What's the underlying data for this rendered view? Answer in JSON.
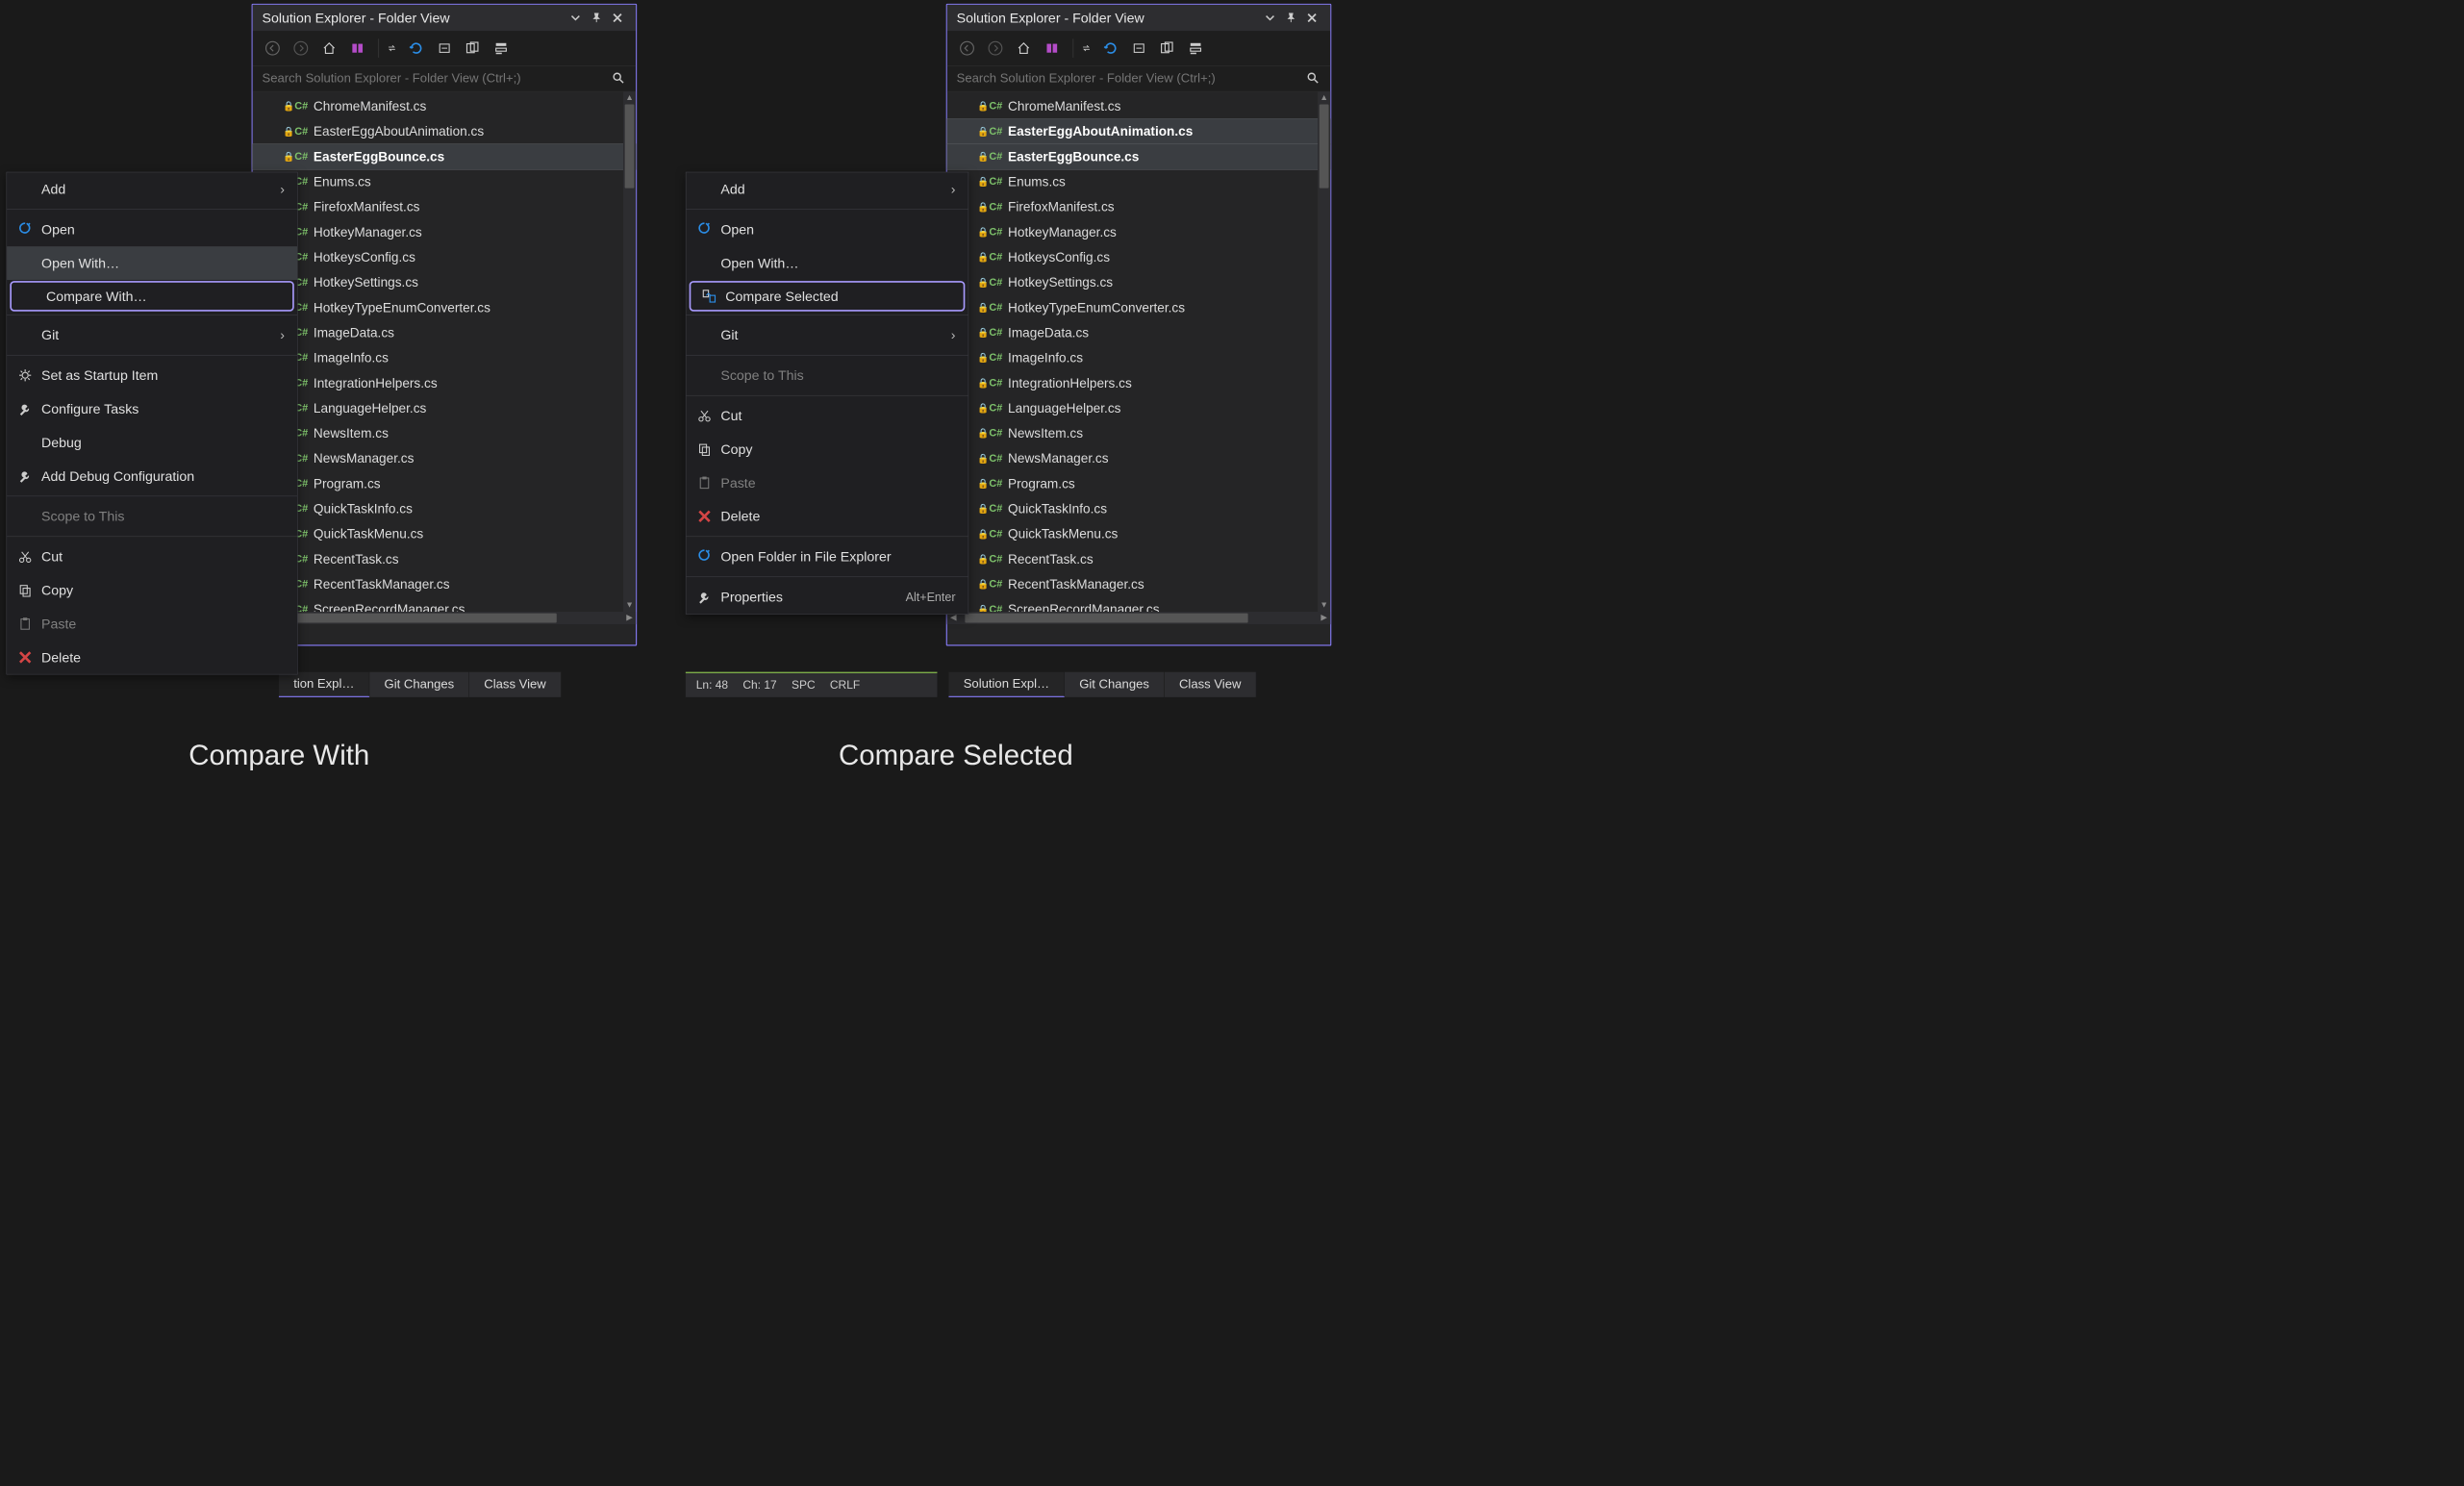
{
  "panel": {
    "title": "Solution Explorer - Folder View",
    "search_placeholder": "Search Solution Explorer - Folder View (Ctrl+;)",
    "files": [
      "ChromeManifest.cs",
      "EasterEggAboutAnimation.cs",
      "EasterEggBounce.cs",
      "Enums.cs",
      "FirefoxManifest.cs",
      "HotkeyManager.cs",
      "HotkeysConfig.cs",
      "HotkeySettings.cs",
      "HotkeyTypeEnumConverter.cs",
      "ImageData.cs",
      "ImageInfo.cs",
      "IntegrationHelpers.cs",
      "LanguageHelper.cs",
      "NewsItem.cs",
      "NewsManager.cs",
      "Program.cs",
      "QuickTaskInfo.cs",
      "QuickTaskMenu.cs",
      "RecentTask.cs",
      "RecentTaskManager.cs",
      "ScreenRecordManager.cs"
    ],
    "cs_badge": "C#",
    "left_selected": [
      2
    ],
    "right_selected": [
      1,
      2
    ]
  },
  "tabs": {
    "sol_expl_trunc": "tion Expl…",
    "sol_expl": "Solution Expl…",
    "git_changes": "Git Changes",
    "class_view": "Class View"
  },
  "status": {
    "ln": "Ln: 48",
    "ch": "Ch: 17",
    "spc": "SPC",
    "crlf": "CRLF"
  },
  "ctx1": {
    "add": "Add",
    "open": "Open",
    "open_with": "Open With…",
    "compare_with": "Compare With…",
    "git": "Git",
    "set_startup": "Set as Startup Item",
    "configure_tasks": "Configure Tasks",
    "debug": "Debug",
    "add_debug_cfg": "Add Debug Configuration",
    "scope": "Scope to This",
    "cut": "Cut",
    "copy": "Copy",
    "paste": "Paste",
    "delete": "Delete"
  },
  "ctx2": {
    "add": "Add",
    "open": "Open",
    "open_with": "Open With…",
    "compare_selected": "Compare Selected",
    "git": "Git",
    "scope": "Scope to This",
    "cut": "Cut",
    "copy": "Copy",
    "paste": "Paste",
    "delete": "Delete",
    "open_folder": "Open Folder in File Explorer",
    "properties": "Properties",
    "properties_hint": "Alt+Enter"
  },
  "captions": {
    "left": "Compare With",
    "right": "Compare Selected"
  }
}
